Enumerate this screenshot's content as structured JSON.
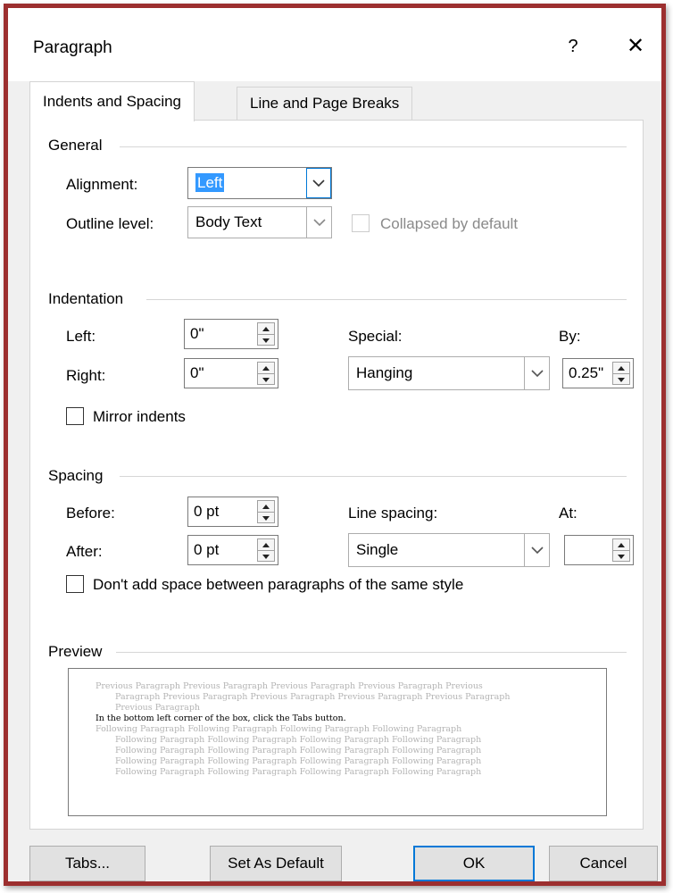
{
  "dialog": {
    "title": "Paragraph",
    "help_glyph": "?",
    "close_glyph": "✕"
  },
  "tabs": [
    {
      "label": "Indents and Spacing",
      "active": true
    },
    {
      "label": "Line and Page Breaks",
      "active": false
    }
  ],
  "general": {
    "title": "General",
    "alignment_label": "Alignment:",
    "alignment_value": "Left",
    "outline_label": "Outline level:",
    "outline_value": "Body Text",
    "collapsed_label": "Collapsed by default",
    "collapsed_checked": false,
    "collapsed_enabled": false
  },
  "indentation": {
    "title": "Indentation",
    "left_label": "Left:",
    "left_value": "0\"",
    "right_label": "Right:",
    "right_value": "0\"",
    "special_label": "Special:",
    "special_value": "Hanging",
    "by_label": "By:",
    "by_value": "0.25\"",
    "mirror_label": "Mirror indents",
    "mirror_checked": false
  },
  "spacing": {
    "title": "Spacing",
    "before_label": "Before:",
    "before_value": "0 pt",
    "after_label": "After:",
    "after_value": "0 pt",
    "line_spacing_label": "Line spacing:",
    "line_spacing_value": "Single",
    "at_label": "At:",
    "at_value": "",
    "dont_add_label": "Don't add space between paragraphs of the same style",
    "dont_add_checked": false
  },
  "preview": {
    "title": "Preview",
    "lines": [
      {
        "text": "Previous Paragraph Previous Paragraph Previous Paragraph Previous Paragraph Previous",
        "indent": 0,
        "current": false
      },
      {
        "text": "Paragraph Previous Paragraph Previous Paragraph Previous Paragraph Previous Paragraph",
        "indent": 1,
        "current": false
      },
      {
        "text": "Previous Paragraph",
        "indent": 1,
        "current": false
      },
      {
        "text": "In the bottom left corner of the box, click the Tabs button.",
        "indent": 0,
        "current": true
      },
      {
        "text": "Following Paragraph Following Paragraph Following Paragraph Following Paragraph",
        "indent": 0,
        "current": false
      },
      {
        "text": "Following Paragraph Following Paragraph Following Paragraph Following Paragraph",
        "indent": 1,
        "current": false
      },
      {
        "text": "Following Paragraph Following Paragraph Following Paragraph Following Paragraph",
        "indent": 1,
        "current": false
      },
      {
        "text": "Following Paragraph Following Paragraph Following Paragraph Following Paragraph",
        "indent": 1,
        "current": false
      },
      {
        "text": "Following Paragraph Following Paragraph Following Paragraph Following Paragraph",
        "indent": 1,
        "current": false
      }
    ]
  },
  "buttons": {
    "tabs": "Tabs...",
    "set_default": "Set As Default",
    "ok": "OK",
    "cancel": "Cancel"
  },
  "colors": {
    "frame_border": "#9c2f2f",
    "selection": "#3399ff",
    "default_button_border": "#0078d7"
  },
  "icons": {
    "help": "question-mark",
    "close": "x-close",
    "dropdown": "chevron-down",
    "spin": "up-down-triangles"
  }
}
